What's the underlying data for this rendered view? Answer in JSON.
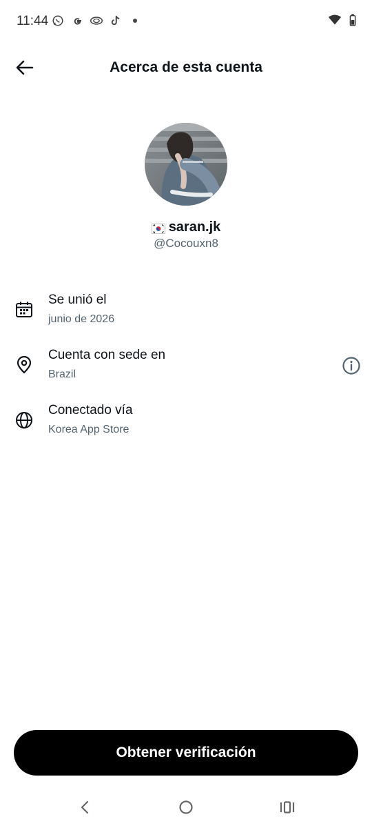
{
  "status_bar": {
    "time": "11:44",
    "left_icons": [
      "whatsapp-icon",
      "google-icon",
      "app-icon",
      "tiktok-icon",
      "dot-icon"
    ],
    "right_icons": [
      "wifi-icon",
      "battery-icon"
    ]
  },
  "header": {
    "title": "Acerca de esta cuenta"
  },
  "profile": {
    "display_name": "saran.jk",
    "flag": "south-korea-flag",
    "handle": "@Cocouxn8"
  },
  "info_items": [
    {
      "icon": "calendar-icon",
      "label": "Se unió el",
      "value": "junio de 2026"
    },
    {
      "icon": "location-pin-icon",
      "label": "Cuenta con sede en",
      "value": "Brazil",
      "has_info": true
    },
    {
      "icon": "globe-icon",
      "label": "Conectado vía",
      "value": "Korea App Store"
    }
  ],
  "cta": {
    "label": "Obtener verificación"
  },
  "colors": {
    "text_primary": "#0f1419",
    "text_secondary": "#536471",
    "button_bg": "#000000",
    "button_text": "#ffffff"
  }
}
